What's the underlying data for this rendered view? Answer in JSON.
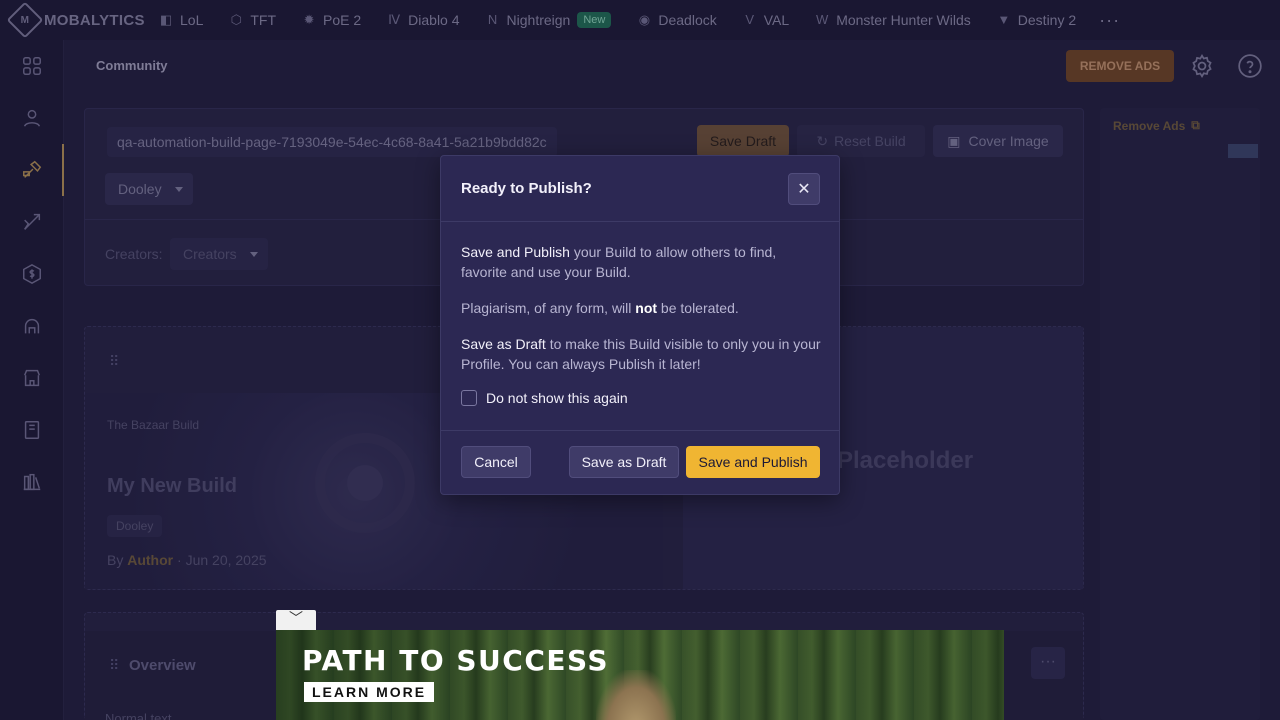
{
  "brand": {
    "name": "MOBALYTICS"
  },
  "nav": {
    "items": [
      {
        "label": "LoL",
        "icon": "lol-icon"
      },
      {
        "label": "TFT",
        "icon": "tft-icon"
      },
      {
        "label": "PoE 2",
        "icon": "poe2-icon"
      },
      {
        "label": "Diablo 4",
        "icon": "diablo4-icon"
      },
      {
        "label": "Nightreign",
        "icon": "nightreign-icon",
        "badge": "New"
      },
      {
        "label": "Deadlock",
        "icon": "deadlock-icon"
      },
      {
        "label": "VAL",
        "icon": "val-icon"
      },
      {
        "label": "Monster Hunter Wilds",
        "icon": "mhw-icon"
      },
      {
        "label": "Destiny 2",
        "icon": "destiny2-icon"
      }
    ],
    "more": "···"
  },
  "header": {
    "breadcrumb": "Community",
    "remove_ads": "REMOVE ADS"
  },
  "editor": {
    "url_value": "qa-automation-build-page-7193049e-54ec-4c68-8a41-5a21b9bdd82c",
    "save_draft": "Save Draft",
    "reset_build": "Reset Build",
    "cover_image": "Cover Image",
    "character": "Dooley",
    "creators_label": "Creators:",
    "creators_placeholder": "Creators"
  },
  "preview": {
    "game": "The Bazaar Build",
    "title": "My New Build",
    "tag": "Dooley",
    "by": "By",
    "author": "Author",
    "separator": "·",
    "date": "Jun 20, 2025",
    "placeholder": "Placeholder"
  },
  "overview": {
    "title": "Overview",
    "text_style": "Normal text",
    "more": "···"
  },
  "side_ad": {
    "link": "Remove Ads"
  },
  "modal": {
    "title": "Ready to Publish?",
    "close": "✕",
    "p1_em": "Save and Publish",
    "p1_rest": " your Build to allow others to find, favorite and use your Build.",
    "p2_a": "Plagiarism, of any form, will ",
    "p2_b": "not",
    "p2_c": " be tolerated.",
    "p3_em": "Save as Draft",
    "p3_rest": " to make this Build visible to only you in your Profile. You can always Publish it later!",
    "checkbox_label": "Do not show this again",
    "checkbox_checked": false,
    "cancel": "Cancel",
    "save_as_draft": "Save as Draft",
    "save_and_publish": "Save and Publish"
  },
  "bottom_ad": {
    "headline": "PATH TO SUCCESS",
    "cta": "LEARN MORE",
    "collapse": "﹀"
  },
  "colors": {
    "accent": "#f0b532",
    "background": "#221f3f",
    "modal": "#2c2853"
  }
}
